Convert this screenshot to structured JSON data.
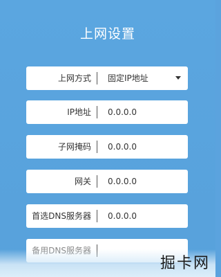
{
  "page": {
    "title": "上网设置"
  },
  "form": {
    "fields": [
      {
        "label": "上网方式",
        "value": "固定IP地址"
      },
      {
        "label": "IP地址",
        "value": "0.0.0.0"
      },
      {
        "label": "子网掩码",
        "value": "0.0.0.0"
      },
      {
        "label": "网关",
        "value": "0.0.0.0"
      },
      {
        "label": "首选DNS服务器",
        "value": "0.0.0.0"
      },
      {
        "label": "备用DNS服务器",
        "value": ""
      }
    ]
  },
  "watermark": {
    "text": "掘卡网"
  },
  "colors": {
    "background": "#5ba3de",
    "field_background": "#ffffff",
    "title_text": "#ffffff"
  }
}
